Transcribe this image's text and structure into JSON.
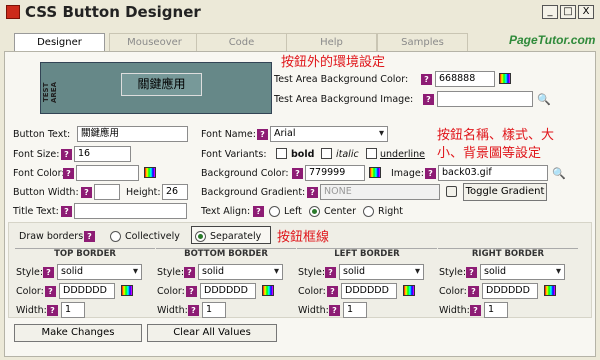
{
  "window": {
    "title": "CSS Button Designer",
    "minimize": "_",
    "maximize": "□",
    "close": "X"
  },
  "tabs": [
    {
      "label": "Designer",
      "active": true
    },
    {
      "label": "Mouseover",
      "active": false
    },
    {
      "label": "Code",
      "active": false
    },
    {
      "label": "Help",
      "active": false
    },
    {
      "label": "Samples",
      "active": false
    }
  ],
  "brand": "PageTutor.com",
  "test_area": {
    "side_label": "TEST AREA",
    "button_text": "關鍵應用",
    "bg_color_label": "Test Area Background Color:",
    "bg_color_value": "668888",
    "bg_image_label": "Test Area Background Image:",
    "bg_image_value": "",
    "annotation": "按鈕外的環境設定"
  },
  "fields": {
    "button_text_label": "Button Text:",
    "button_text_value": "關鍵應用",
    "font_size_label": "Font Size:",
    "font_size_value": "16",
    "font_color_label": "Font Color:",
    "font_color_value": "",
    "button_width_label": "Button Width:",
    "button_width_value": "",
    "height_label": "Height:",
    "height_value": "26",
    "title_text_label": "Title Text:",
    "title_text_value": "",
    "font_name_label": "Font Name:",
    "font_name_value": "Arial",
    "font_variants_label": "Font Variants:",
    "bold_label": "bold",
    "italic_label": "italic",
    "underline_label": "underline",
    "bg_color_label": "Background Color:",
    "bg_color_value": "779999",
    "image_label": "Image:",
    "image_value": "back03.gif",
    "bg_gradient_label": "Background Gradient:",
    "bg_gradient_value": "NONE",
    "toggle_gradient": "Toggle Gradient",
    "text_align_label": "Text Align:",
    "align_left": "Left",
    "align_center": "Center",
    "align_right": "Right",
    "annotation_line1": "按鈕名稱、樣式、大",
    "annotation_line2": "小、背景圖等設定"
  },
  "borders": {
    "draw_label": "Draw borders:",
    "collectively": "Collectively",
    "separately": "Separately",
    "annotation": "按鈕框線",
    "columns": [
      {
        "heading": "TOP BORDER",
        "style_label": "Style:",
        "style": "solid",
        "color_label": "Color:",
        "color": "DDDDDD",
        "width_label": "Width:",
        "width": "1"
      },
      {
        "heading": "BOTTOM BORDER",
        "style_label": "Style:",
        "style": "solid",
        "color_label": "Color:",
        "color": "DDDDDD",
        "width_label": "Width:",
        "width": "1"
      },
      {
        "heading": "LEFT BORDER",
        "style_label": "Style:",
        "style": "solid",
        "color_label": "Color:",
        "color": "DDDDDD",
        "width_label": "Width:",
        "width": "1"
      },
      {
        "heading": "RIGHT BORDER",
        "style_label": "Style:",
        "style": "solid",
        "color_label": "Color:",
        "color": "DDDDDD",
        "width_label": "Width:",
        "width": "1"
      }
    ]
  },
  "actions": {
    "make_changes": "Make Changes",
    "clear_all": "Clear All Values"
  },
  "help_glyph": "?",
  "colors": {
    "test_area_bg": "#668888",
    "button_bg": "#779999",
    "annotation": "#e0161b",
    "help_icon": "#8d1c74",
    "brand": "#2f8a3a"
  }
}
